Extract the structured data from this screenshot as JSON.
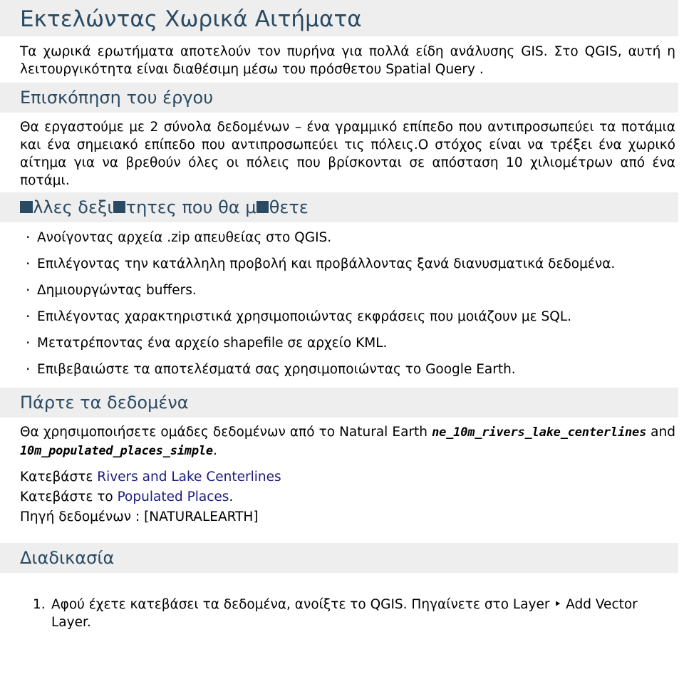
{
  "doc": {
    "title": "Εκτελώντας Χωρικά Αιτήματα",
    "intro": "Τα χωρικά ερωτήματα αποτελούν τον πυρήνα για πολλά είδη ανάλυσης GIS. Στο QGIS, αυτή η λειτουργικότητα είναι διαθέσιμη μέσω του πρόσθετου Spatial Query ."
  },
  "colors": {
    "heading": "#2a4a63",
    "band_background": "#eeeeee",
    "link": "#1b1b7e",
    "body_text": "#000000",
    "page_background": "#ffffff"
  },
  "sections": {
    "overview": {
      "heading": "Επισκόπηση του έργου",
      "body": "Θα εργαστούμε με 2 σύνολα δεδομένων – ένα γραμμικό επίπεδο που αντιπροσωπεύει τα ποτάμια και ένα σημειακό επίπεδο που αντιπροσωπεύει τις πόλεις.Ο στόχος είναι να τρέξει ένα χωρικό αίτημα για να βρεθούν όλες οι πόλεις που βρίσκονται σε απόσταση 10 χιλιομέτρων από ένα ποτάμι."
    },
    "other_skills": {
      "heading_part1": "",
      "heading_part2": "λλες δεξι",
      "heading_part3": "τητες που θα μ",
      "heading_part4": "θετε",
      "heading_plain": "■λλες δεξι■τητες που θα μ■θετε",
      "bullets": [
        "Ανοίγοντας αρχεία .zip απευθείας στο QGIS.",
        "Επιλέγοντας την κατάλληλη προβολή και προβάλλοντας ξανά διανυσματικά δεδομένα.",
        "Δημιουργώντας buffers.",
        "Επιλέγοντας χαρακτηριστικά χρησιμοποιώντας εκφράσεις που μοιάζουν με SQL.",
        "Μετατρέποντας ένα αρχείο shapefile σε αρχείο KML.",
        "Επιβεβαιώστε τα αποτελέσματά σας χρησιμοποιώντας το Google Earth."
      ]
    },
    "get_data": {
      "heading": "Πάρτε τα δεδομένα",
      "body_prefix": "Θα χρησιμοποιήσετε ομάδες δεδομένων από το Natural Earth",
      "code1": "ne_10m_rivers_lake_centerlines",
      "conjunction": "and",
      "code2": "10m_populated_places_simple",
      "body_suffix": ".",
      "download_label_1": "Κατεβάστε",
      "download_link_1": "Rivers and Lake Centerlines",
      "download_label_2": "Κατεβάστε το",
      "download_link_2": "Populated Places",
      "download_suffix_2": ".",
      "source_line": "Πηγή δεδομένων : [NATURALEARTH]"
    },
    "procedure": {
      "heading": "Διαδικασία",
      "steps": [
        "Αφού έχετε κατεβάσει τα δεδομένα, ανοίξτε το QGIS. Πηγαίνετε στο Layer ‣ Add Vector Layer."
      ]
    }
  }
}
